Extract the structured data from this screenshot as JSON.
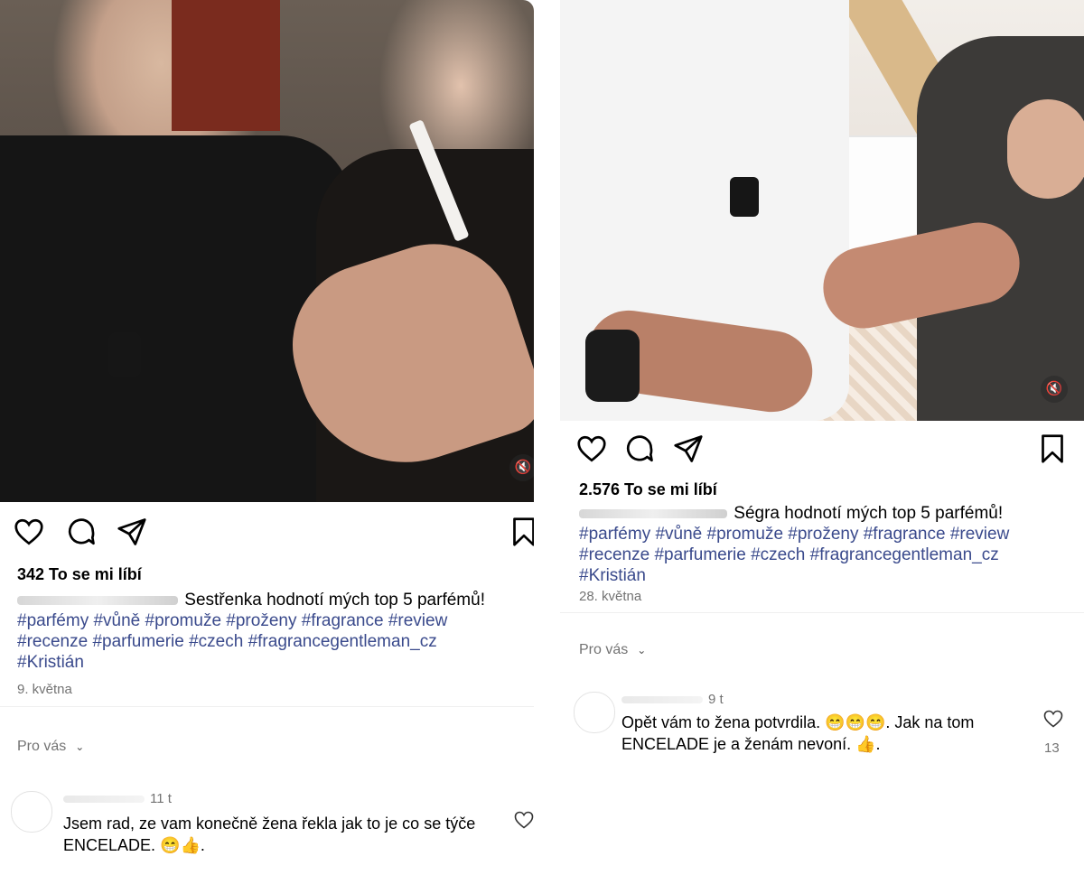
{
  "left_post": {
    "likes": "342 To se mi líbí",
    "caption_text": "Sestřenka hodnotí mých top 5 parfémů!",
    "hashtags_line1": "#parfémy  #vůně #promuže #proženy #fragrance #review",
    "hashtags_line2": "#recenze #parfumerie #czech #fragrancegentleman_cz",
    "hashtags_line3": "#Kristián",
    "date": "9. května",
    "for_you": "Pro vás",
    "comment": {
      "time": "11 t",
      "text": "Jsem rad, ze vam konečně žena řekla jak to je co se týče ENCELADE. 😁👍."
    }
  },
  "right_post": {
    "likes": "2.576 To se mi líbí",
    "caption_text": "Ségra hodnotí mých top 5 parfémů!",
    "hashtags_line1": "#parfémy  #vůně #promuže #proženy #fragrance #review",
    "hashtags_line2": "#recenze #parfumerie #czech #fragrancegentleman_cz",
    "hashtags_line3": "#Kristián",
    "date": "28. května",
    "for_you": "Pro vás",
    "comment": {
      "time": "9 t",
      "text": "Opět vám to žena potvrdila. 😁😁😁. Jak na tom ENCELADE je a ženám nevoní. 👍.",
      "likes": "13"
    }
  },
  "icons": {
    "like": "heart-icon",
    "comment": "comment-icon",
    "share": "send-icon",
    "save": "bookmark-icon",
    "mute": "muted-speaker-icon",
    "expand": "chevron-down-icon"
  },
  "colors": {
    "hashtag": "#3a4a8c",
    "secondary_text": "#737373"
  }
}
